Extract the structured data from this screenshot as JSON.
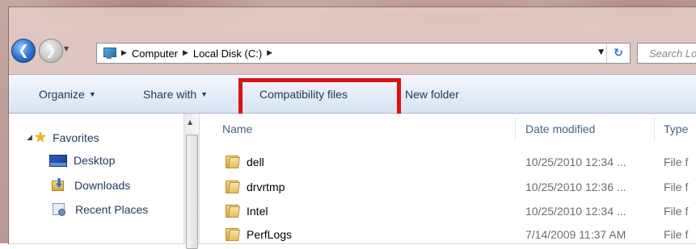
{
  "window": {
    "title_bar": ""
  },
  "nav": {
    "back_icon": "back-arrow-icon",
    "forward_icon": "forward-arrow-icon",
    "recent_pages_icon": "chevron-down-icon"
  },
  "address": {
    "location_icon": "computer-icon",
    "crumbs": [
      "Computer",
      "Local Disk (C:)"
    ],
    "dropdown_icon": "chevron-down-icon",
    "refresh_icon": "refresh-icon"
  },
  "search": {
    "placeholder": "Search Local Disk (C:)"
  },
  "toolbar": {
    "organize": "Organize",
    "share_with": "Share with",
    "compatibility_files": "Compatibility files",
    "new_folder": "New folder",
    "highlight_color": "#e01010"
  },
  "navigation_pane": {
    "favorites_label": "Favorites",
    "items": [
      {
        "label": "Desktop",
        "icon": "desktop-icon"
      },
      {
        "label": "Downloads",
        "icon": "downloads-folder-icon"
      },
      {
        "label": "Recent Places",
        "icon": "recent-places-icon"
      }
    ]
  },
  "file_list": {
    "columns": {
      "name": "Name",
      "date_modified": "Date modified",
      "type": "Type"
    },
    "rows": [
      {
        "name": "dell",
        "date": "10/25/2010 12:34 ...",
        "type": "File f"
      },
      {
        "name": "drvrtmp",
        "date": "10/25/2010 12:36 ...",
        "type": "File f"
      },
      {
        "name": "Intel",
        "date": "10/25/2010 12:34 ...",
        "type": "File f"
      },
      {
        "name": "PerfLogs",
        "date": "7/14/2009 11:37 AM",
        "type": "File f"
      }
    ]
  }
}
